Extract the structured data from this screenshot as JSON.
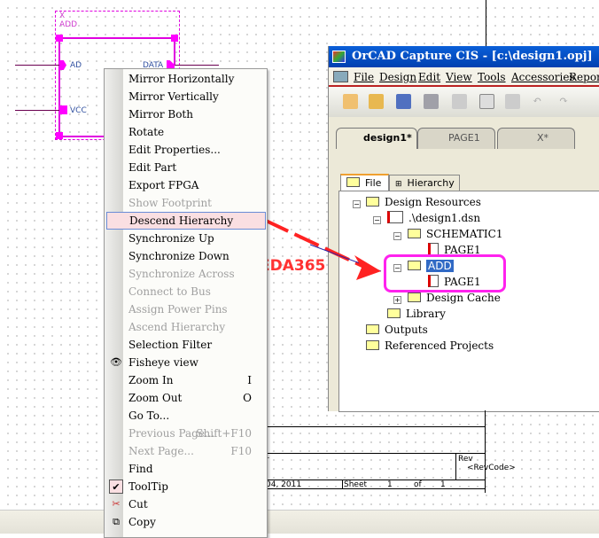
{
  "schematic": {
    "ref": "X",
    "part": "ADD",
    "pins": [
      "AD",
      "VCC",
      "DATA"
    ]
  },
  "context_menu": {
    "items": [
      {
        "label": "Mirror Horizontally",
        "state": "enabled"
      },
      {
        "label": "Mirror Vertically",
        "state": "enabled"
      },
      {
        "label": "Mirror Both",
        "state": "enabled"
      },
      {
        "label": "Rotate",
        "state": "enabled"
      },
      {
        "label": "Edit Properties...",
        "state": "enabled"
      },
      {
        "label": "Edit Part",
        "state": "enabled"
      },
      {
        "label": "Export FPGA",
        "state": "enabled"
      },
      {
        "label": "Show Footprint",
        "state": "disabled"
      },
      {
        "label": "Descend Hierarchy",
        "state": "highlighted"
      },
      {
        "label": "Synchronize Up",
        "state": "enabled"
      },
      {
        "label": "Synchronize Down",
        "state": "enabled"
      },
      {
        "label": "Synchronize Across",
        "state": "disabled"
      },
      {
        "label": "Connect to Bus",
        "state": "disabled"
      },
      {
        "label": "Assign Power Pins",
        "state": "disabled"
      },
      {
        "label": "Ascend Hierarchy",
        "state": "disabled"
      },
      {
        "label": "Selection Filter",
        "state": "enabled"
      },
      {
        "label": "Fisheye view",
        "state": "enabled",
        "icon": "eye-icon"
      },
      {
        "label": "Zoom In",
        "state": "enabled",
        "shortcut": "I"
      },
      {
        "label": "Zoom Out",
        "state": "enabled",
        "shortcut": "O"
      },
      {
        "label": "Go To...",
        "state": "enabled"
      },
      {
        "label": "Previous Page...",
        "state": "disabled",
        "shortcut": "Shift+F10"
      },
      {
        "label": "Next Page...",
        "state": "disabled",
        "shortcut": "F10"
      },
      {
        "label": "Find",
        "state": "enabled"
      },
      {
        "label": "ToolTip",
        "state": "enabled",
        "icon": "check-icon"
      },
      {
        "label": "Cut",
        "state": "enabled",
        "icon": "scissors-icon"
      },
      {
        "label": "Copy",
        "state": "enabled",
        "icon": "copy-icon"
      }
    ]
  },
  "window": {
    "title": "OrCAD Capture CIS - [c:\\design1.opj]",
    "menu": [
      "File",
      "Design",
      "Edit",
      "View",
      "Tools",
      "Accessories",
      "Reports"
    ],
    "tabs": [
      "design1*",
      "PAGE1",
      "X*"
    ],
    "panel_tabs": [
      "File",
      "Hierarchy"
    ],
    "tree": [
      "Design Resources",
      ".\\design1.dsn",
      "SCHEMATIC1",
      "PAGE1",
      "ADD",
      "PAGE1",
      "Design Cache",
      "Library",
      "Outputs",
      "Referenced Projects"
    ]
  },
  "annotation": {
    "label": "EDA365",
    "color": "#ff3333"
  },
  "title_block": {
    "rev_label": "Rev",
    "rev_code": "<RevCode>",
    "date": "04, 2011",
    "sheet_label": "Sheet",
    "sheet": "1",
    "of_label": "of",
    "total": "1",
    "fragment": "r"
  }
}
